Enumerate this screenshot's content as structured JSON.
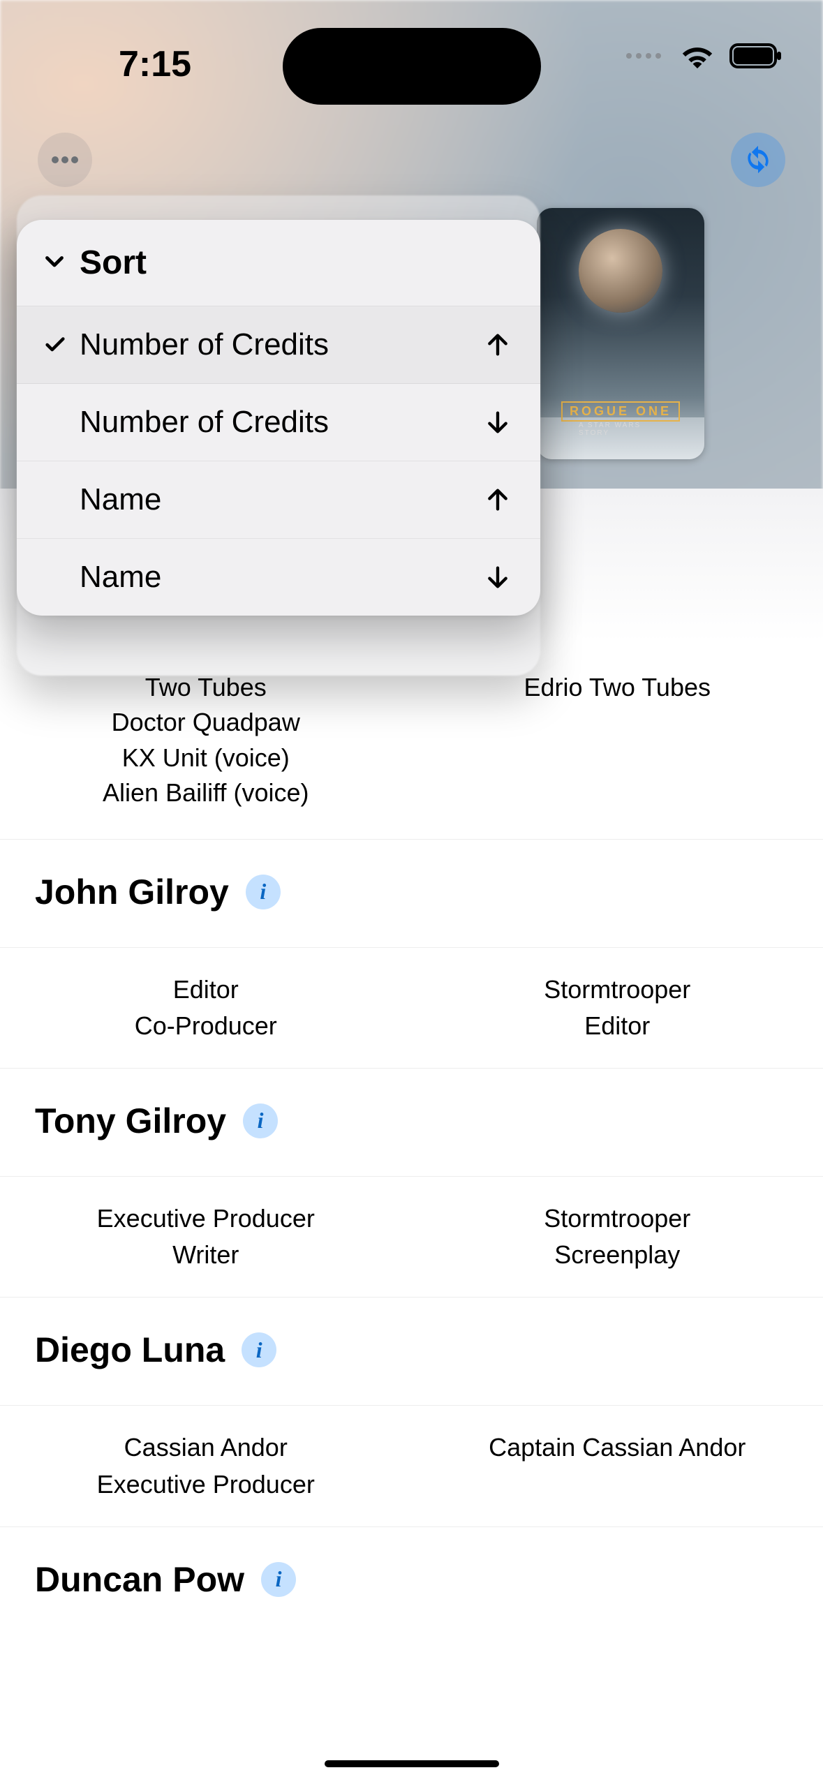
{
  "statusbar": {
    "time": "7:15"
  },
  "nav": {
    "more_icon": "more-icon",
    "refresh_icon": "refresh-icon"
  },
  "poster": {
    "title": "ROGUE ONE",
    "subtitle": "A STAR WARS STORY"
  },
  "sort": {
    "header": "Sort",
    "options": [
      {
        "label": "Number of Credits",
        "direction": "up",
        "selected": true
      },
      {
        "label": "Number of Credits",
        "direction": "down",
        "selected": false
      },
      {
        "label": "Name",
        "direction": "up",
        "selected": false
      },
      {
        "label": "Name",
        "direction": "down",
        "selected": false
      }
    ]
  },
  "partial_top": {
    "left_lines": [
      "Two Tubes",
      "Doctor Quadpaw",
      "KX Unit (voice)",
      "Alien Bailiff (voice)"
    ],
    "right_lines": [
      "Edrio Two Tubes"
    ]
  },
  "people": [
    {
      "name": "John Gilroy",
      "left_lines": [
        "Editor",
        "Co-Producer"
      ],
      "right_lines": [
        "Stormtrooper",
        "Editor"
      ]
    },
    {
      "name": "Tony Gilroy",
      "left_lines": [
        "Executive Producer",
        "Writer"
      ],
      "right_lines": [
        "Stormtrooper",
        "Screenplay"
      ]
    },
    {
      "name": "Diego Luna",
      "left_lines": [
        "Cassian Andor",
        "Executive Producer"
      ],
      "right_lines": [
        "Captain Cassian Andor"
      ]
    },
    {
      "name": "Duncan Pow",
      "left_lines": [],
      "right_lines": []
    }
  ]
}
